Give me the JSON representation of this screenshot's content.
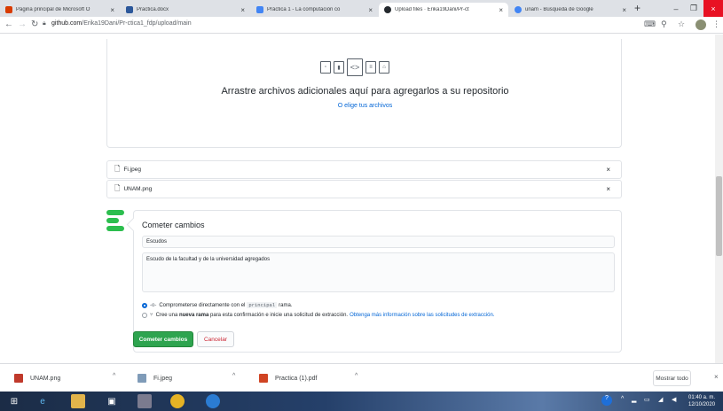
{
  "browser": {
    "tabs": [
      {
        "title": "Página principal de Microsoft O",
        "active": false,
        "color": "#d83b01"
      },
      {
        "title": "Practica.docx",
        "active": false,
        "color": "#2b579a"
      },
      {
        "title": "Práctica 1 - La computación co",
        "active": false,
        "color": "#4285f4"
      },
      {
        "title": "Upload files · Erika19Dani/Pr-ct",
        "active": true,
        "color": "#24292e"
      },
      {
        "title": "unam - Búsqueda de Google",
        "active": false,
        "color": "#4285f4"
      }
    ],
    "new_tab": "+",
    "url_host": "github.com",
    "url_path": "/Erika19Dani/Pr-ctica1_fdp/upload/main"
  },
  "dropzone": {
    "icons": [
      "file-icon",
      "chart-file-icon",
      "code-file-icon",
      "text-file-icon",
      "pdf-file-icon"
    ],
    "title": "Arrastre archivos adicionales aquí para agregarlos a su repositorio",
    "link": "O elige tus archivos"
  },
  "files": [
    {
      "name": "Fi.jpeg"
    },
    {
      "name": "UNAM.png"
    }
  ],
  "commit": {
    "title": "Cometer cambios",
    "summary_value": "Escudos",
    "description_value": "Escudo de la facultad y de la universidad agregados",
    "option_direct_pre": "Comprometerse directamente con el",
    "option_direct_branch": "principal",
    "option_direct_post": "rama.",
    "option_new_pre": "Cree una",
    "option_new_bold": "nueva rama",
    "option_new_post": "para esta confirmación e inicie una solicitud de extracción.",
    "option_new_link": "Obtenga más información sobre las solicitudes de extracción.",
    "submit_label": "Cometer cambios",
    "cancel_label": "Cancelar"
  },
  "downloads": {
    "items": [
      {
        "name": "UNAM.png"
      },
      {
        "name": "Fi.jpeg"
      },
      {
        "name": "Practica (1).pdf"
      }
    ],
    "show_all": "Mostrar todo"
  },
  "taskbar": {
    "time": "01:40 a. m.",
    "date": "12/10/2020"
  },
  "colors": {
    "primary_green": "#2ea44f",
    "link_blue": "#0366d6",
    "cancel_red": "#cb2431"
  }
}
